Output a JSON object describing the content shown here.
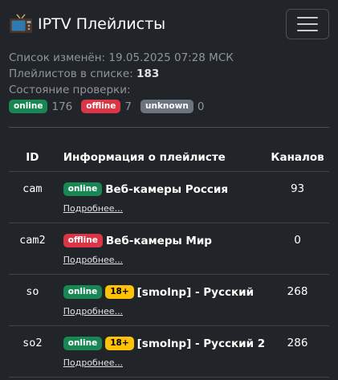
{
  "navbar": {
    "brand": "IPTV Плейлисты",
    "brand_icon": "tv-icon",
    "menu_icon": "hamburger-menu-icon"
  },
  "info": {
    "updated": "Список изменён: 19.05.2025 07:28 МСК",
    "count_label": "Плейлистов в списке: ",
    "count_value": "183",
    "check_label": "Состояние проверки:",
    "status": [
      {
        "label": "online",
        "count": "176",
        "color": "#198754"
      },
      {
        "label": "offline",
        "count": "7",
        "color": "#dc3545"
      },
      {
        "label": "unknown",
        "count": "0",
        "color": "#6c757d"
      }
    ]
  },
  "table": {
    "headers": {
      "id": "ID",
      "info": "Информация о плейлисте",
      "channels": "Каналов"
    },
    "rows": [
      {
        "id": "cam",
        "status": "online",
        "age": "",
        "title": "Веб-камеры Россия",
        "link": "Подробнее...",
        "channels": "93"
      },
      {
        "id": "cam2",
        "status": "offline",
        "age": "",
        "title": "Веб-камеры Мир",
        "link": "Подробнее...",
        "channels": "0"
      },
      {
        "id": "so",
        "status": "online",
        "age": "18+",
        "title": "[smolnp] - Русский",
        "link": "Подробнее...",
        "channels": "268"
      },
      {
        "id": "so2",
        "status": "online",
        "age": "18+",
        "title": "[smolnp] - Русский 2",
        "link": "Подробнее...",
        "channels": "286"
      }
    ]
  },
  "colors": {
    "background": "#212529",
    "online": "#198754",
    "offline": "#dc3545",
    "unknown": "#6c757d",
    "age": "#ffc107"
  }
}
